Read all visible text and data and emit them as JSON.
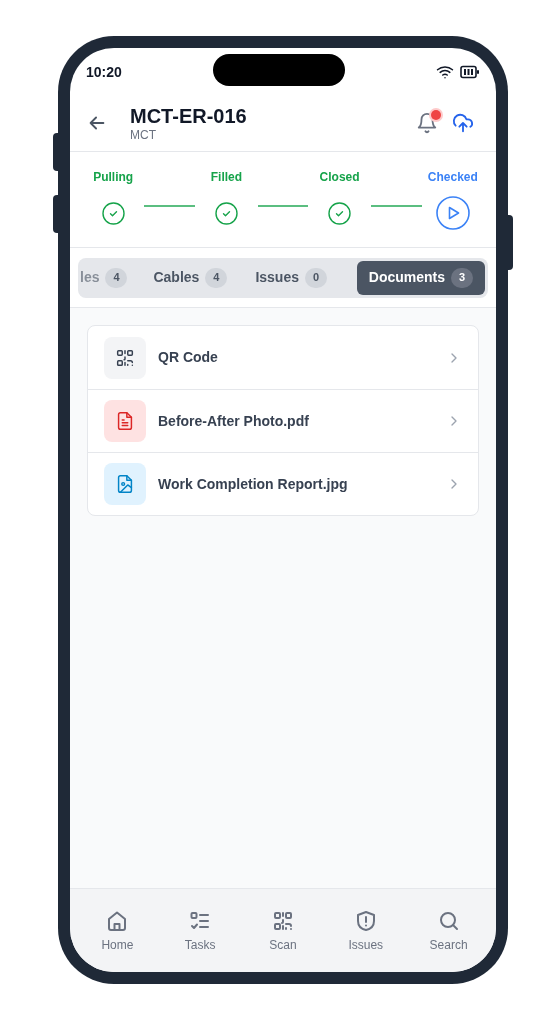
{
  "status_bar": {
    "time": "10:20"
  },
  "header": {
    "title": "MCT-ER-016",
    "subtitle": "MCT",
    "notification_unread": true
  },
  "steps": [
    {
      "label": "Pulling",
      "completed": true
    },
    {
      "label": "Filled",
      "completed": true
    },
    {
      "label": "Closed",
      "completed": true
    },
    {
      "label": "Checked",
      "completed": false
    }
  ],
  "tabs": [
    {
      "label": "les",
      "count": "4",
      "selected": false
    },
    {
      "label": "Cables",
      "count": "4",
      "selected": false
    },
    {
      "label": "Issues",
      "count": "0",
      "selected": false
    },
    {
      "label": "Documents",
      "count": "3",
      "selected": true
    }
  ],
  "documents": [
    {
      "name": "QR Code",
      "kind": "qr"
    },
    {
      "name": "Before-After Photo.pdf",
      "kind": "pdf"
    },
    {
      "name": "Work Completion Report.jpg",
      "kind": "image"
    }
  ],
  "bottom_nav": [
    {
      "label": "Home",
      "kind": "home",
      "selected": false
    },
    {
      "label": "Tasks",
      "kind": "tasks",
      "selected": false
    },
    {
      "label": "Scan",
      "kind": "scan",
      "selected": false
    },
    {
      "label": "Issues",
      "kind": "issues",
      "selected": false
    },
    {
      "label": "Search",
      "kind": "search",
      "selected": false
    }
  ]
}
